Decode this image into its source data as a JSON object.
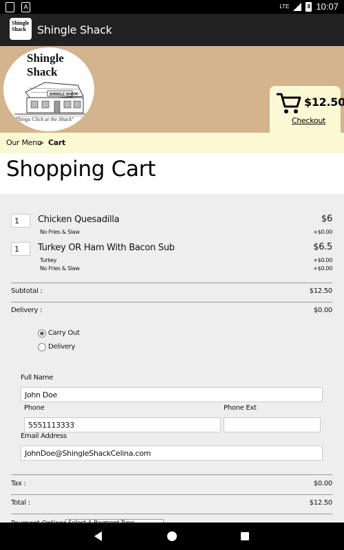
{
  "status_bar": {
    "time": "10:07",
    "network": "LTE",
    "battery": "8"
  },
  "app_bar": {
    "title": "Shingle Shack",
    "logo_text": "Shingle Shack"
  },
  "banner": {
    "logo_line1": "Shingle",
    "logo_line2": "Shack",
    "logo_sign": "SHINGLE SHACK",
    "tagline": "\"Things Click at the Shack\"",
    "cart_total": "$12.50",
    "checkout_label": "Checkout"
  },
  "breadcrumb": {
    "parent": "Our Menu",
    "separator": ">",
    "current": "Cart"
  },
  "page_title": "Shopping Cart",
  "cart": {
    "items": [
      {
        "qty": "1",
        "name": "Chicken Quesadilla",
        "price": "$6",
        "modifiers": [
          {
            "name": "No Fries & Slaw",
            "price": "+$0.00"
          }
        ]
      },
      {
        "qty": "1",
        "name": "Turkey OR Ham With Bacon Sub",
        "price": "$6.5",
        "modifiers": [
          {
            "name": "Turkey",
            "price": "+$0.00"
          },
          {
            "name": "No Fries & Slaw",
            "price": "+$0.00"
          }
        ]
      }
    ],
    "subtotal_label": "Subtotal :",
    "subtotal_value": "$12.50",
    "delivery_label": "Delivery :",
    "delivery_value": "$0.00",
    "options": [
      {
        "label": "Carry Out",
        "selected": true
      },
      {
        "label": "Delivery",
        "selected": false
      }
    ],
    "full_name_label": "Full Name",
    "full_name_value": "John Doe",
    "phone_label": "Phone",
    "phone_value": "5551113333",
    "phone_ext_label": "Phone Ext",
    "phone_ext_value": "",
    "email_label": "Email Address",
    "email_value": "JohnDoe@ShingleShackCelina.com",
    "tax_label": "Tax :",
    "tax_value": "$0.00",
    "total_label": "Total :",
    "total_value": "$12.50",
    "payment_label": "Payment Options :",
    "payment_select": "Select A Payment Type"
  }
}
